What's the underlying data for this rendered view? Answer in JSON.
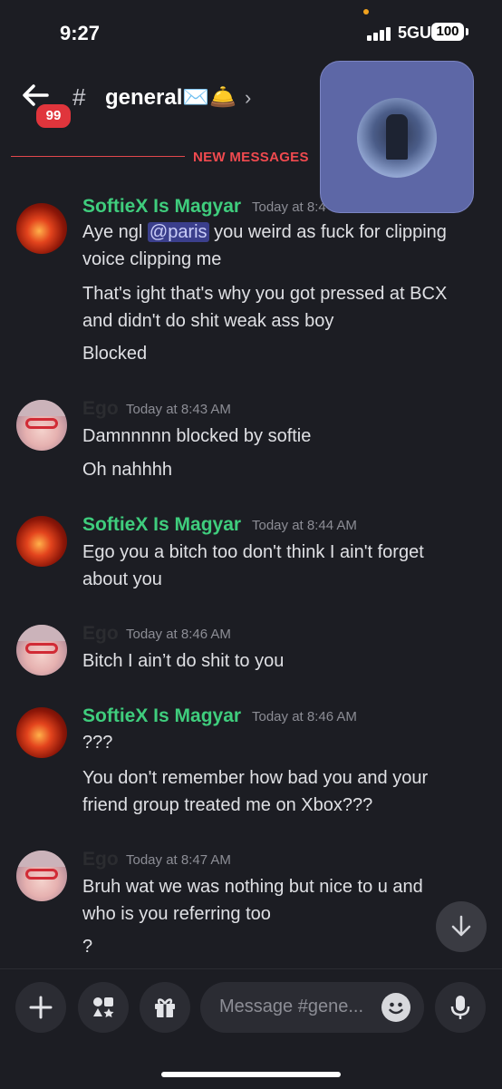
{
  "status_bar": {
    "time": "9:27",
    "network": "5GUC",
    "battery": "100"
  },
  "header": {
    "unread_badge": "99",
    "hash": "#",
    "channel_name": "general✉️🛎️",
    "chevron": "›"
  },
  "divider": {
    "label": "NEW MESSAGES"
  },
  "messages": [
    {
      "author": "SoftieX Is Magyar",
      "timestamp": "Today at 8:4",
      "lines": [
        {
          "pre": "Aye ngl ",
          "mention": "@paris",
          "post": " you weird as fuck for clipping"
        },
        "voice clipping me",
        "That's ight that's why you got pressed at BCX",
        "and didn't do shit weak ass boy",
        "Blocked"
      ]
    },
    {
      "author": "Ego",
      "timestamp": "Today at 8:43 AM",
      "lines": [
        "Damnnnnn blocked by softie",
        "Oh nahhhh"
      ]
    },
    {
      "author": "SoftieX Is Magyar",
      "timestamp": "Today at 8:44 AM",
      "lines": [
        "Ego you a bitch too don't think I ain't forget",
        "about you"
      ]
    },
    {
      "author": "Ego",
      "timestamp": "Today at 8:46 AM",
      "lines": [
        "Bitch I ain’t do shit to you"
      ]
    },
    {
      "author": "SoftieX Is Magyar",
      "timestamp": "Today at 8:46 AM",
      "lines": [
        "???",
        "You don't remember how bad you and your",
        "friend group treated me on Xbox???"
      ]
    },
    {
      "author": "Ego",
      "timestamp": "Today at 8:47 AM",
      "lines": [
        "Bruh wat we was nothing but nice to u and",
        "who is you referring too",
        "?"
      ]
    }
  ],
  "composer": {
    "placeholder": "Message #gene..."
  },
  "colors": {
    "background": "#1c1d23",
    "accent_green": "#3fcd7d",
    "new_messages_red": "#f04a4f",
    "mention_bg": "#3b3f8c",
    "pip_bg": "#5d67a6"
  },
  "icons": [
    "back-arrow-icon",
    "hash-icon",
    "chevron-right-icon",
    "plus-icon",
    "apps-icon",
    "gift-icon",
    "emoji-icon",
    "microphone-icon",
    "arrow-down-icon"
  ]
}
